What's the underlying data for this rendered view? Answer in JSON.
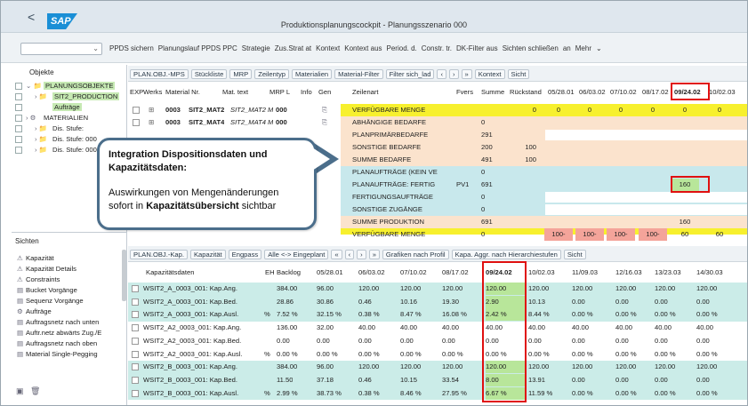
{
  "window": {
    "title": "Produktionsplanungscockpit - Planungsszenario 000",
    "logo_text": "SAP",
    "back_label": "<"
  },
  "toolbar": {
    "items": [
      "PPDS sichern",
      "Planungslauf PPDS PPC",
      "Strategie",
      "Zus.Strat at",
      "Kontext",
      "Kontext aus",
      "Period. d.",
      "Constr. tr.",
      "DK-Filter aus",
      "Sichten schließen",
      "an",
      "Mehr"
    ]
  },
  "left": {
    "objects_header": "Objekte",
    "tree": [
      {
        "label": "PLANUNGSOBJEKTE",
        "highlighted": true
      },
      {
        "label": "SIT2_PRODUCTION",
        "highlighted": true
      },
      {
        "label": "Aufträge",
        "highlighted": true
      },
      {
        "label": "MATERIALIEN",
        "highlighted": false
      },
      {
        "label": "Dis. Stufe:",
        "highlighted": false
      },
      {
        "label": "Dis. Stufe: 000",
        "highlighted": false
      },
      {
        "label": "Dis. Stufe: 000",
        "highlighted": false
      }
    ],
    "views_header": "Sichten",
    "views": [
      "Kapazität",
      "Kapazität Details",
      "Constraints",
      "Bucket Vorgänge",
      "Sequenz Vorgänge",
      "Aufträge",
      "Auftragsnetz nach unten",
      "Auftr.netz abwärts Zug./E",
      "Auftragsnetz nach oben",
      "Material Single-Pegging"
    ]
  },
  "upper_grid": {
    "toolbar": [
      "PLAN.OBJ.-MPS",
      "Stückliste",
      "MRP",
      "Zeilentyp",
      "Materialien",
      "Material-Filter",
      "Filter sich_lad",
      "‹",
      "›",
      "»",
      "Kontext",
      "Sicht"
    ],
    "headers": {
      "exp": "EXP",
      "werks": "Werks",
      "material": "Material Nr.",
      "mat_text": "Mat. text",
      "mrp": "MRP L",
      "info": "Info",
      "gen": "Gen",
      "zeilenart": "Zeilenart",
      "fvers": "Fvers",
      "summe": "Summe",
      "rueckstand": "Rückstand"
    },
    "periods": [
      "05/28.01",
      "06/03.02",
      "07/10.02",
      "08/17.02",
      "09/24.02",
      "10/02.03"
    ],
    "materials": [
      {
        "werks": "0003",
        "material": "SIT2_MAT2",
        "text": "SIT2_MAT2 M",
        "mrp": "000"
      },
      {
        "werks": "0003",
        "material": "SIT2_MAT4",
        "text": "SIT2_MAT4 M",
        "mrp": "000"
      }
    ],
    "rows": [
      {
        "label": "VERFÜGBARE MENGE",
        "fvers": "",
        "summe": "",
        "rueck": "0",
        "p": [
          "0",
          "0",
          "0",
          "0",
          "0",
          "0"
        ]
      },
      {
        "label": "ABHÄNGIGE BEDARFE",
        "fvers": "",
        "summe": "0",
        "rueck": "",
        "p": [
          "",
          "",
          "",
          "",
          "",
          ""
        ]
      },
      {
        "label": "PLANPRIMÄRBEDARFE",
        "fvers": "",
        "summe": "291",
        "rueck": "",
        "p": [
          "",
          "",
          "",
          "",
          "",
          ""
        ]
      },
      {
        "label": "SONSTIGE BEDARFE",
        "fvers": "",
        "summe": "200",
        "rueck": "100",
        "p": [
          "",
          "",
          "",
          "",
          "",
          ""
        ]
      },
      {
        "label": "SUMME BEDARFE",
        "fvers": "",
        "summe": "491",
        "rueck": "100",
        "p": [
          "",
          "",
          "",
          "",
          "",
          ""
        ]
      },
      {
        "label": "PLANAUFTRÄGE (KEIN VE",
        "fvers": "",
        "summe": "0",
        "rueck": "",
        "p": [
          "",
          "",
          "",
          "",
          "",
          ""
        ]
      },
      {
        "label": "PLANAUFTRÄGE: FERTIG",
        "fvers": "PV1",
        "summe": "691",
        "rueck": "",
        "p": [
          "",
          "",
          "",
          "",
          "160",
          ""
        ]
      },
      {
        "label": "FERTIGUNGSAUFTRÄGE",
        "fvers": "",
        "summe": "0",
        "rueck": "",
        "p": [
          "",
          "",
          "",
          "",
          "",
          ""
        ]
      },
      {
        "label": "SONSTIGE ZUGÄNGE",
        "fvers": "",
        "summe": "0",
        "rueck": "",
        "p": [
          "",
          "",
          "",
          "",
          "",
          ""
        ]
      },
      {
        "label": "SUMME PRODUKTION",
        "fvers": "",
        "summe": "691",
        "rueck": "",
        "p": [
          "",
          "",
          "",
          "",
          "160",
          ""
        ]
      },
      {
        "label": "VERFÜGBARE MENGE",
        "fvers": "",
        "summe": "0",
        "rueck": "",
        "p": [
          "100-",
          "100-",
          "100-",
          "100-",
          "60",
          "60"
        ]
      }
    ]
  },
  "lower_grid": {
    "toolbar": [
      "PLAN.OBJ.-Kap.",
      "Kapazität",
      "Engpass",
      "Alle <-> Eingeplant",
      "«",
      "‹",
      "›",
      "»",
      "Grafiken nach Profil",
      "Kapa. Aggr. nach Hierarchiestufen",
      "Sicht"
    ],
    "headers": {
      "kap": "Kapazitätsdaten",
      "eh": "EH",
      "backlog": "Backlog"
    },
    "periods": [
      "05/28.01",
      "06/03.02",
      "07/10.02",
      "08/17.02",
      "09/24.02",
      "10/02.03",
      "11/09.03",
      "12/16.03",
      "13/23.03",
      "14/30.03"
    ],
    "rows": [
      {
        "label": "WSIT2_A_0003_001: Kap.Ang.",
        "eh": "",
        "v": [
          "384.00",
          "96.00",
          "120.00",
          "120.00",
          "120.00",
          "120.00",
          "120.00",
          "120.00",
          "120.00",
          "120.00",
          "120.00"
        ]
      },
      {
        "label": "WSIT2_A_0003_001: Kap.Bed.",
        "eh": "",
        "v": [
          "28.86",
          "30.86",
          "0.46",
          "10.16",
          "19.30",
          "2.90",
          "10.13",
          "0.00",
          "0.00",
          "0.00",
          "0.00"
        ]
      },
      {
        "label": "WSIT2_A_0003_001: Kap.Ausl.",
        "eh": "%",
        "v": [
          "7.52 %",
          "32.15 %",
          "0.38 %",
          "8.47 %",
          "16.08 %",
          "2.42 %",
          "8.44 %",
          "0.00 %",
          "0.00 %",
          "0.00 %",
          "0.00 %"
        ]
      },
      {
        "label": "WSIT2_A2_0003_001: Kap.Ang.",
        "eh": "",
        "v": [
          "136.00",
          "32.00",
          "40.00",
          "40.00",
          "40.00",
          "40.00",
          "40.00",
          "40.00",
          "40.00",
          "40.00",
          "40.00"
        ]
      },
      {
        "label": "WSIT2_A2_0003_001: Kap.Bed.",
        "eh": "",
        "v": [
          "0.00",
          "0.00",
          "0.00",
          "0.00",
          "0.00",
          "0.00",
          "0.00",
          "0.00",
          "0.00",
          "0.00",
          "0.00"
        ]
      },
      {
        "label": "WSIT2_A2_0003_001: Kap.Ausl.",
        "eh": "%",
        "v": [
          "0.00 %",
          "0.00 %",
          "0.00 %",
          "0.00 %",
          "0.00 %",
          "0.00 %",
          "0.00 %",
          "0.00 %",
          "0.00 %",
          "0.00 %",
          "0.00 %"
        ]
      },
      {
        "label": "WSIT2_B_0003_001: Kap.Ang.",
        "eh": "",
        "v": [
          "384.00",
          "96.00",
          "120.00",
          "120.00",
          "120.00",
          "120.00",
          "120.00",
          "120.00",
          "120.00",
          "120.00",
          "120.00"
        ]
      },
      {
        "label": "WSIT2_B_0003_001: Kap.Bed.",
        "eh": "",
        "v": [
          "11.50",
          "37.18",
          "0.46",
          "10.15",
          "33.54",
          "8.00",
          "13.91",
          "0.00",
          "0.00",
          "0.00",
          "0.00"
        ]
      },
      {
        "label": "WSIT2_B_0003_001: Kap.Ausl.",
        "eh": "%",
        "v": [
          "2.99 %",
          "38.73 %",
          "0.38 %",
          "8.46 %",
          "27.95 %",
          "6.67 %",
          "11.59 %",
          "0.00 %",
          "0.00 %",
          "0.00 %",
          "0.00 %"
        ]
      }
    ]
  },
  "callout": {
    "title": "Integration Dispositionsdaten und Kapazitätsdaten:",
    "text_prefix": "Auswirkungen von Mengenänderungen sofort in ",
    "text_bold": "Kapazitätsübersicht",
    "text_suffix": " sichtbar"
  },
  "colors": {
    "accent_red": "#e01010",
    "highlight_green": "#b8e69a",
    "band_yellow": "#f7f02e",
    "band_peach": "#fbe3cd",
    "band_teal": "#c8e8ec",
    "band_red": "#f4a49a",
    "kap_teal": "#cbece8"
  }
}
